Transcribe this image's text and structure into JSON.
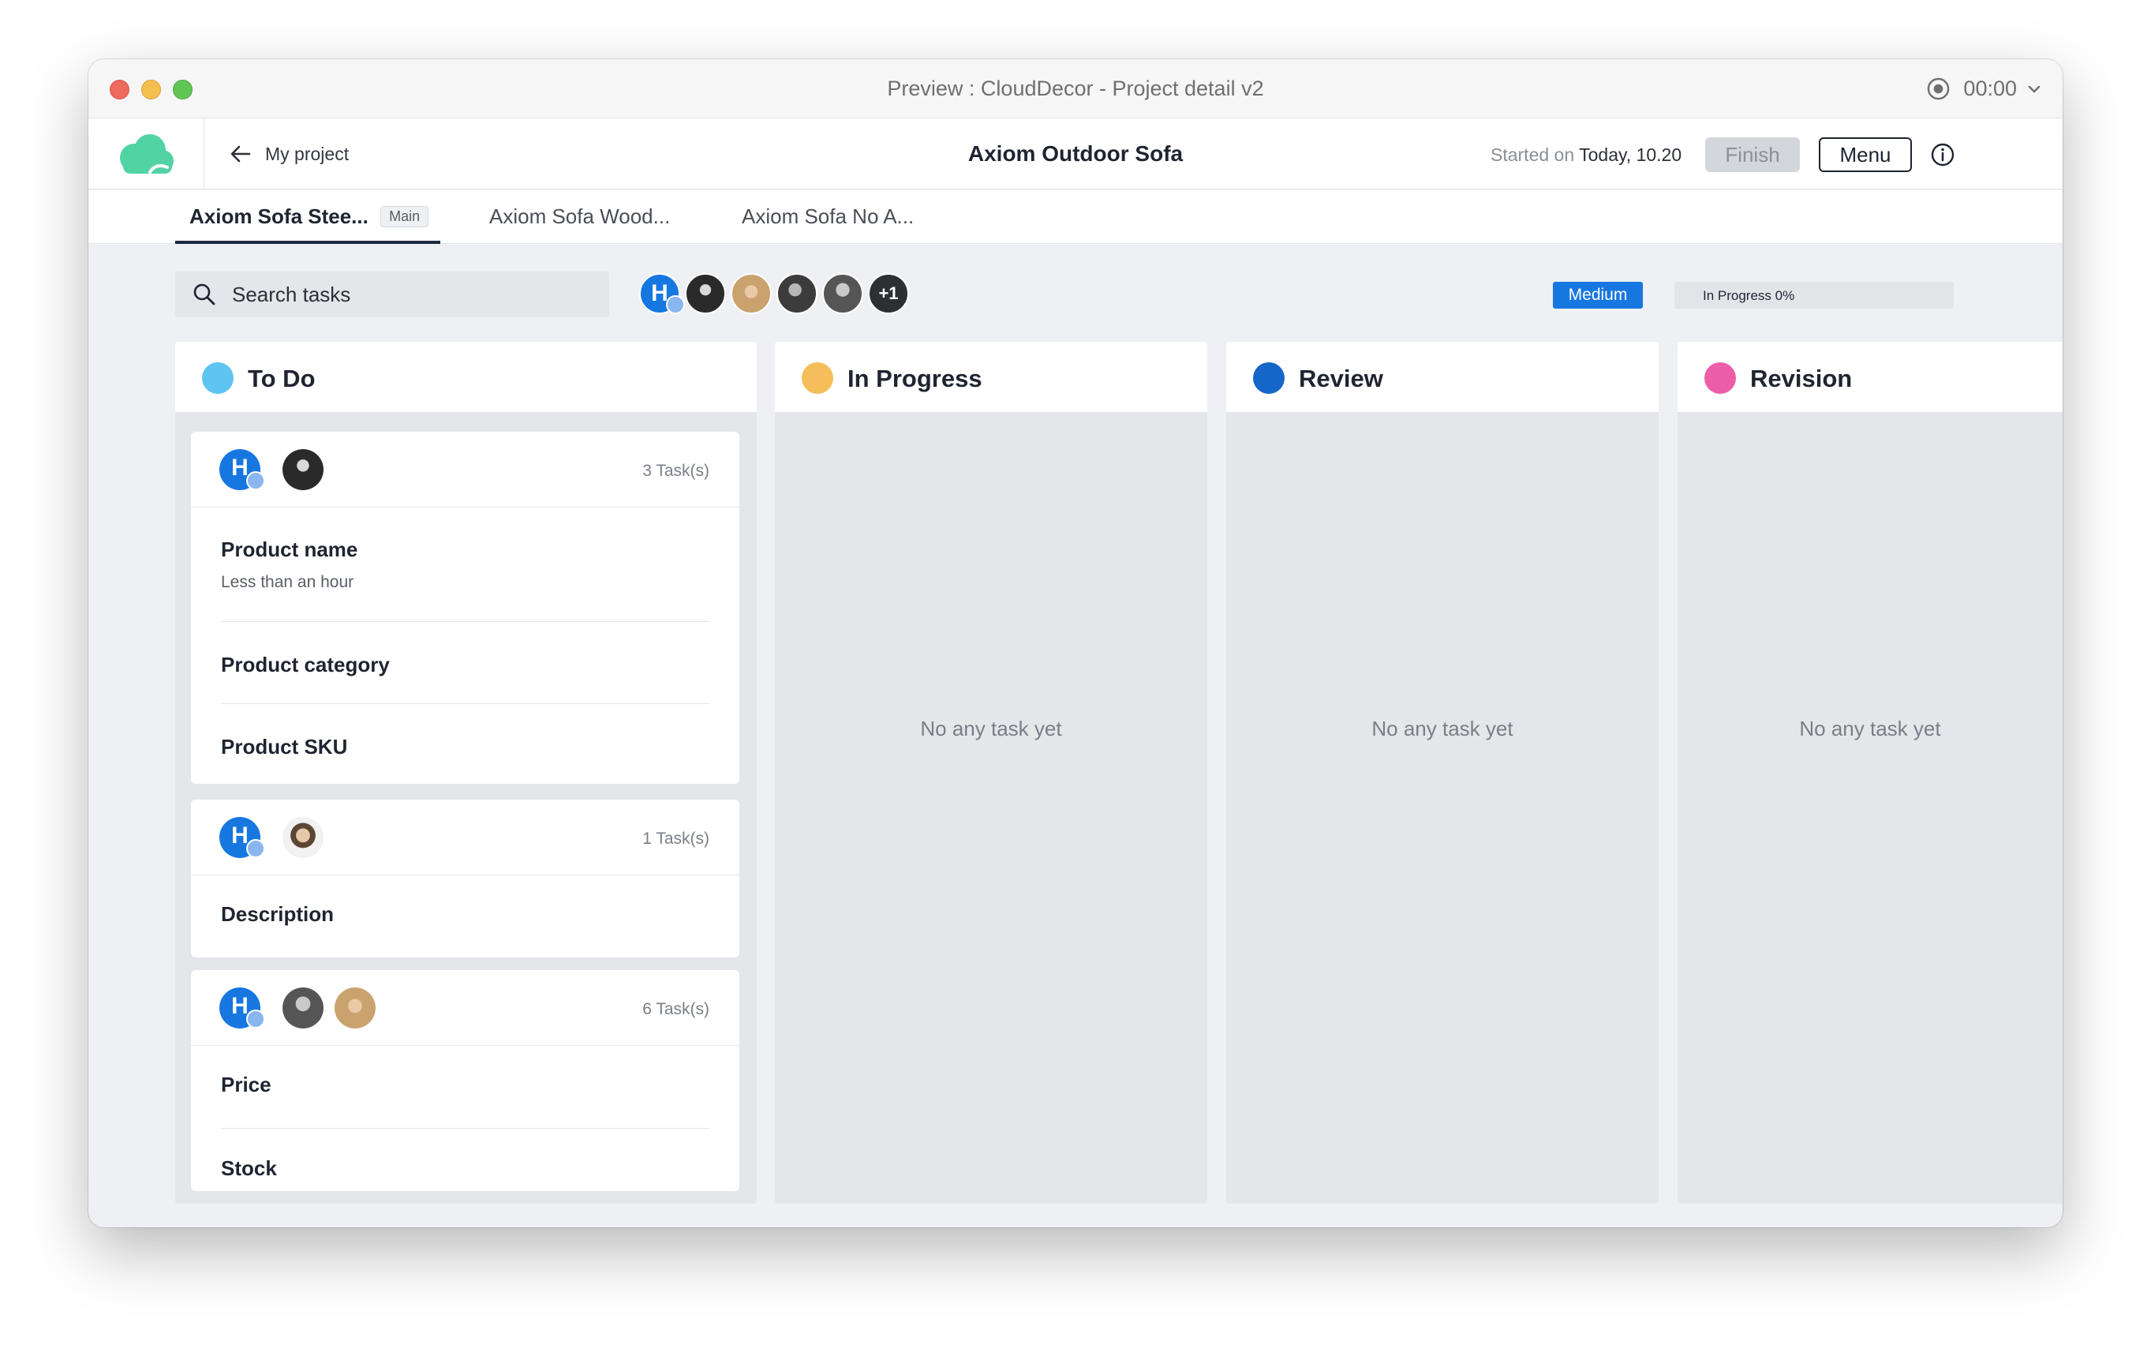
{
  "window": {
    "title": "Preview : CloudDecor - Project detail v2",
    "timer": "00:00"
  },
  "header": {
    "back_label": "My project",
    "project_title": "Axiom Outdoor Sofa",
    "started_prefix": "Started on",
    "started_value": "Today, 10.20",
    "finish_label": "Finish",
    "menu_label": "Menu"
  },
  "tabs": [
    {
      "label": "Axiom Sofa Stee...",
      "badge": "Main"
    },
    {
      "label": "Axiom Sofa Wood..."
    },
    {
      "label": "Axiom Sofa No A..."
    }
  ],
  "toolbar": {
    "search_placeholder": "Search tasks",
    "avatar_initial": "H",
    "more_count": "+1",
    "priority": "Medium",
    "progress_label": "In Progress 0%",
    "progress_fraction": 0
  },
  "columns": [
    {
      "title": "To Do",
      "color": "#5ec4f2"
    },
    {
      "title": "In Progress",
      "color": "#f5be5a",
      "empty": "No any task yet"
    },
    {
      "title": "Review",
      "color": "#1466c8",
      "empty": "No any task yet"
    },
    {
      "title": "Revision",
      "color": "#ec5ea8",
      "empty": "No any task yet"
    }
  ],
  "cards": [
    {
      "count": "3 Task(s)",
      "items": [
        {
          "title": "Product name",
          "subtitle": "Less than an hour"
        },
        {
          "title": "Product category"
        },
        {
          "title": "Product SKU"
        }
      ]
    },
    {
      "count": "1 Task(s)",
      "items": [
        {
          "title": "Description"
        }
      ]
    },
    {
      "count": "6 Task(s)",
      "items": [
        {
          "title": "Price"
        },
        {
          "title": "Stock"
        }
      ]
    }
  ],
  "colors": {
    "accent": "#1677e0",
    "brand": "#52d3a4",
    "dark": "#1b2a40"
  }
}
